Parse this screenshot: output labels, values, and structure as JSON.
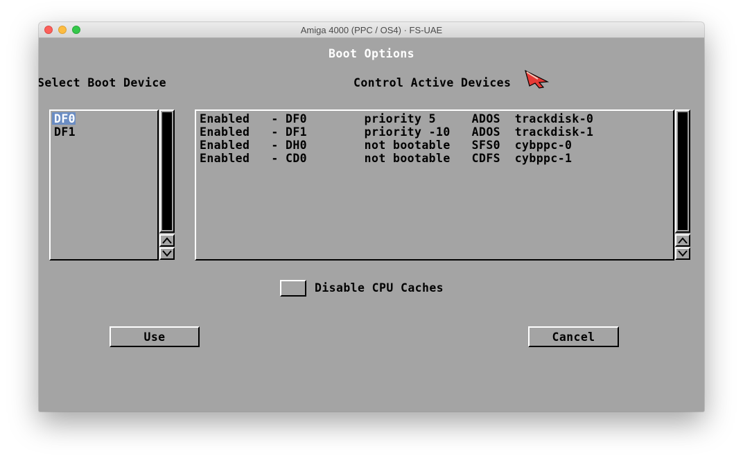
{
  "window": {
    "title": "Amiga 4000 (PPC / OS4) · FS-UAE"
  },
  "requester": {
    "title": "Boot Options",
    "boot_device_heading": "Select Boot Device",
    "boot_devices": [
      {
        "label": "DF0",
        "selected": true
      },
      {
        "label": "DF1",
        "selected": false
      }
    ],
    "active_devices_heading": "Control Active Devices",
    "active_devices": [
      "Enabled   - DF0        priority 5     ADOS  trackdisk-0",
      "Enabled   - DF1        priority -10   ADOS  trackdisk-1",
      "Enabled   - DH0        not bootable   SFS0  cybppc-0",
      "Enabled   - CD0        not bootable   CDFS  cybppc-1"
    ],
    "disable_caches": {
      "label": "Disable CPU Caches",
      "checked": false
    },
    "use_label": "Use",
    "cancel_label": "Cancel"
  },
  "colors": {
    "screen_bg": "#a4a4a4",
    "highlight": "#6b8dc3",
    "title_text": "#ffffff",
    "text": "#000000",
    "pointer": "#e63a36"
  },
  "icons": [
    "close-icon",
    "minimize-icon",
    "zoom-icon",
    "scroll-up-arrow-icon",
    "scroll-down-arrow-icon",
    "mouse-pointer-icon"
  ]
}
